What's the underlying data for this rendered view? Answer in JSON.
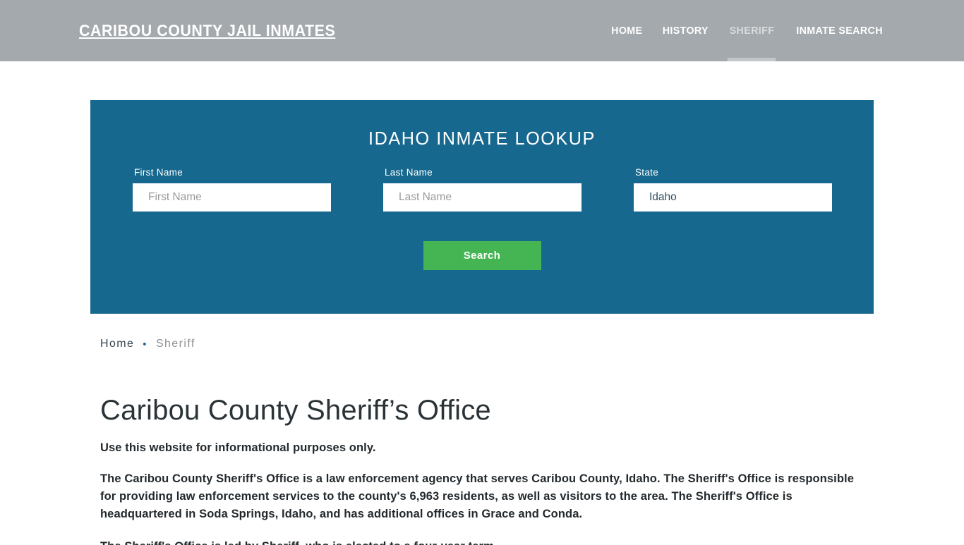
{
  "header": {
    "brand": "CARIBOU COUNTY JAIL INMATES",
    "background_color": "#a4a9ad",
    "nav": [
      {
        "label": "HOME",
        "active": false
      },
      {
        "label": "HISTORY",
        "active": false
      },
      {
        "label": "SHERIFF",
        "active": true
      },
      {
        "label": "INMATE SEARCH",
        "active": false
      }
    ]
  },
  "lookup": {
    "title": "IDAHO INMATE LOOKUP",
    "panel_color": "#16688e",
    "fields": {
      "first_name": {
        "label": "First Name",
        "placeholder": "First Name",
        "value": ""
      },
      "last_name": {
        "label": "Last Name",
        "placeholder": "Last Name",
        "value": ""
      },
      "state": {
        "label": "State",
        "value": "Idaho",
        "options": [
          "Idaho"
        ]
      }
    },
    "search_button": {
      "label": "Search",
      "color": "#45b554"
    }
  },
  "breadcrumb": {
    "home": "Home",
    "separator": "•",
    "current": "Sheriff"
  },
  "main": {
    "title": "Caribou County Sheriff’s Office",
    "lead": "Use this website for informational purposes only.",
    "paragraph": "The Caribou County Sheriff's Office is a law enforcement agency that serves Caribou County, Idaho. The Sheriff's Office is responsible for providing law enforcement services to the county's 6,963 residents, as well as visitors to the area. The Sheriff's Office is headquartered in Soda Springs, Idaho, and has additional offices in Grace and Conda.",
    "paragraph_partial": "The Sheriff's Office is led by Sheriff, who is elected to a four-year term."
  }
}
